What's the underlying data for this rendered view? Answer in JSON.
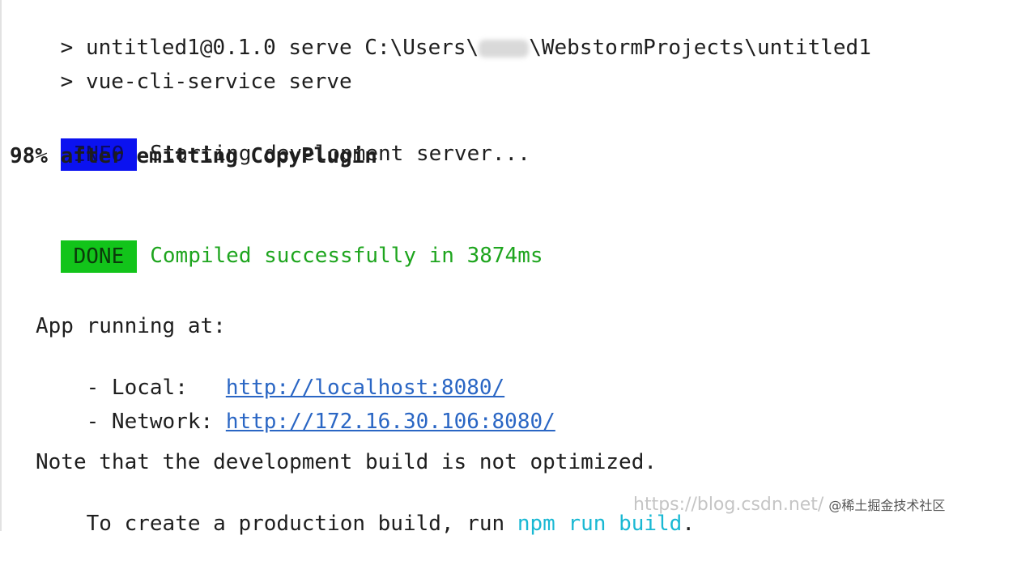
{
  "terminal": {
    "line1": {
      "prompt": "> ",
      "text_before": "untitled1@0.1.0 serve C:\\Users\\",
      "text_after": "\\WebstormProjects\\untitled1"
    },
    "line2": {
      "prompt": "> ",
      "text": "vue-cli-service serve"
    },
    "info": {
      "badge": "INFO",
      "message": "Starting development server..."
    },
    "progress": {
      "text": "98% after emitting CopyPlugin"
    },
    "done": {
      "badge": "DONE",
      "message": "Compiled successfully in 3874ms"
    },
    "app_running": "App running at:",
    "local": {
      "label": "- Local:   ",
      "url": "http://localhost:8080/"
    },
    "network": {
      "label": "- Network: ",
      "url": "http://172.16.30.106:8080/"
    },
    "note": "Note that the development build is not optimized.",
    "create": {
      "text": "To create a production build, run ",
      "command": "npm run build",
      "end": "."
    }
  },
  "watermark": {
    "url": "https://blog.csdn.net/",
    "site": "@稀土掘金技术社区"
  },
  "colors": {
    "info_badge": "#0b12f0",
    "done_badge": "#12c41a",
    "success_text": "#1ea51e",
    "link": "#2a66c4",
    "command": "#19b8d3"
  }
}
